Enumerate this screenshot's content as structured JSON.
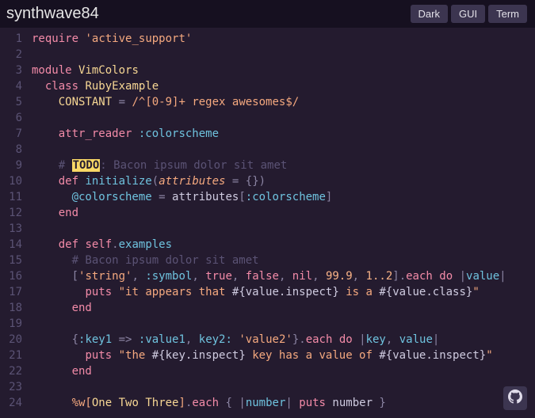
{
  "theme_name": "synthwave84",
  "tabs": {
    "dark": "Dark",
    "gui": "GUI",
    "term": "Term"
  },
  "gutter": [
    "1",
    "2",
    "3",
    "4",
    "5",
    "6",
    "7",
    "8",
    "9",
    "10",
    "11",
    "12",
    "13",
    "14",
    "15",
    "16",
    "17",
    "18",
    "19",
    "20",
    "21",
    "22",
    "23",
    "24"
  ],
  "code": {
    "l1": {
      "kw": "require",
      "sp": " ",
      "q": "'",
      "str": "active_support"
    },
    "l3": {
      "kw": "module",
      "name": "VimColors"
    },
    "l4": {
      "kw": "class",
      "name": "RubyExample"
    },
    "l5": {
      "name": "CONSTANT",
      "eq": " = ",
      "rx_open": "/",
      "rx": "^[0-9]+ regex awesomes$",
      "rx_close": "/"
    },
    "l7": {
      "attr": "attr_reader",
      "sym": ":colorscheme"
    },
    "l9": {
      "hash": "# ",
      "todo": "TODO",
      "colon": ":",
      "rest": " Bacon ipsum dolor sit amet"
    },
    "l10": {
      "def": "def",
      "name": "initialize",
      "op": "(",
      "arg": "attributes",
      "eq": " = ",
      "empty": "{}",
      "cp": ")"
    },
    "l11": {
      "ivar": "@colorscheme",
      "eq": " = ",
      "var": "attributes",
      "ob": "[",
      "sym": ":colorscheme",
      "cb": "]"
    },
    "l12": {
      "end": "end"
    },
    "l14": {
      "def": "def",
      "self": "self",
      "dot": ".",
      "name": "examples"
    },
    "l15": {
      "cmt": "# Bacon ipsum dolor sit amet"
    },
    "l16": {
      "ob": "[",
      "q": "'",
      "s": "string",
      "c": ", ",
      "sym": ":symbol",
      "t": "true",
      "f": "false",
      "n": "nil",
      "num": "99.9",
      "range": "1..2",
      "cb": "]",
      "dot": ".",
      "each": "each",
      "do": "do",
      "pipe": "|",
      "blk": "value"
    },
    "l17": {
      "puts": "puts",
      "q": "\"",
      "s1": "it appears that ",
      "io": "#{",
      "expr1": "value.inspect",
      "ic": "}",
      "s2": " is a ",
      "expr2": "value.class"
    },
    "l18": {
      "end": "end"
    },
    "l20": {
      "ob": "{",
      "k1": ":key1",
      "fat": " => ",
      "v1": ":value1",
      "c": ", ",
      "k2": "key2:",
      "q": "'",
      "v2": "value2",
      "cb": "}",
      "dot": ".",
      "each": "each",
      "do": "do",
      "pipe": "|",
      "b1": "key",
      "b2": "value"
    },
    "l21": {
      "puts": "puts",
      "q": "\"",
      "s1": "the ",
      "io": "#{",
      "e1": "key.inspect",
      "ic": "}",
      "s2": " key has a value of ",
      "e2": "value.inspect"
    },
    "l22": {
      "end": "end"
    },
    "l24": {
      "pw": "%w[",
      "w1": "One",
      "w2": "Two",
      "w3": "Three",
      "cb": "]",
      "dot": ".",
      "each": "each",
      "ob": "{",
      "pipe": " |",
      "blk": "number",
      "pipe2": "| ",
      "puts": "puts",
      "var": "number",
      "cb2": " }"
    }
  }
}
